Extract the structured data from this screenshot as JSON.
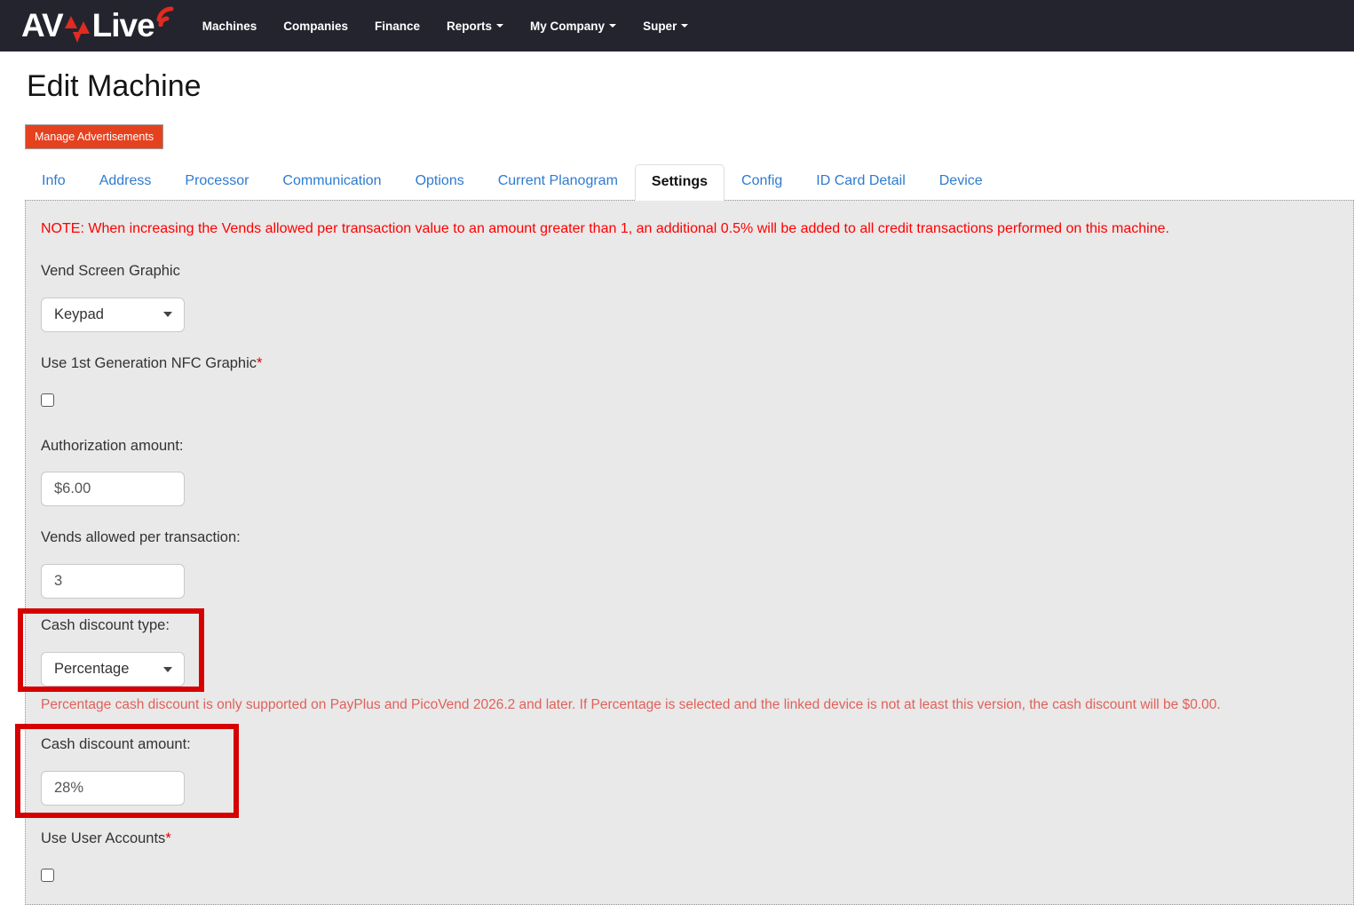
{
  "colors": {
    "navbar_bg": "#24242f",
    "brand_red": "#e02b20",
    "tab_link_blue": "#2e7bcf",
    "button_red": "#e5411e",
    "note_red": "#ff0000",
    "helper_salmon": "#e0615a",
    "annotation_red": "#d60000",
    "panel_gray": "#e9e9e9"
  },
  "navbar": {
    "brand_av": "AV",
    "brand_live": "Live",
    "items": [
      {
        "label": "Machines",
        "has_dropdown": false
      },
      {
        "label": "Companies",
        "has_dropdown": false
      },
      {
        "label": "Finance",
        "has_dropdown": false
      },
      {
        "label": "Reports",
        "has_dropdown": true
      },
      {
        "label": "My Company",
        "has_dropdown": true
      },
      {
        "label": "Super",
        "has_dropdown": true
      }
    ]
  },
  "page": {
    "title": "Edit Machine"
  },
  "actions": {
    "manage_advertisements": "Manage Advertisements"
  },
  "tabs": {
    "active": "Settings",
    "items": [
      "Info",
      "Address",
      "Processor",
      "Communication",
      "Options",
      "Current Planogram",
      "Settings",
      "Config",
      "ID Card Detail",
      "Device"
    ]
  },
  "settings_form": {
    "note": "NOTE: When increasing the Vends allowed per transaction value to an amount greater than 1, an additional 0.5% will be added to all credit transactions performed on this machine.",
    "vend_screen_graphic": {
      "label": "Vend Screen Graphic",
      "value": "Keypad"
    },
    "nfc_graphic": {
      "label": "Use 1st Generation NFC Graphic",
      "required_mark": "*",
      "checked": false
    },
    "authorization_amount": {
      "label": "Authorization amount:",
      "value": "$6.00"
    },
    "vends_allowed": {
      "label": "Vends allowed per transaction:",
      "value": "3"
    },
    "cash_discount_type": {
      "label": "Cash discount type:",
      "value": "Percentage"
    },
    "cash_discount_helper": "Percentage cash discount is only supported on PayPlus and PicoVend 2026.2 and later. If Percentage is selected and the linked device is not at least this version, the cash discount will be $0.00.",
    "cash_discount_amount": {
      "label": "Cash discount amount:",
      "value": "28%"
    },
    "use_user_accounts": {
      "label": "Use User Accounts",
      "required_mark": "*",
      "checked": false
    }
  }
}
